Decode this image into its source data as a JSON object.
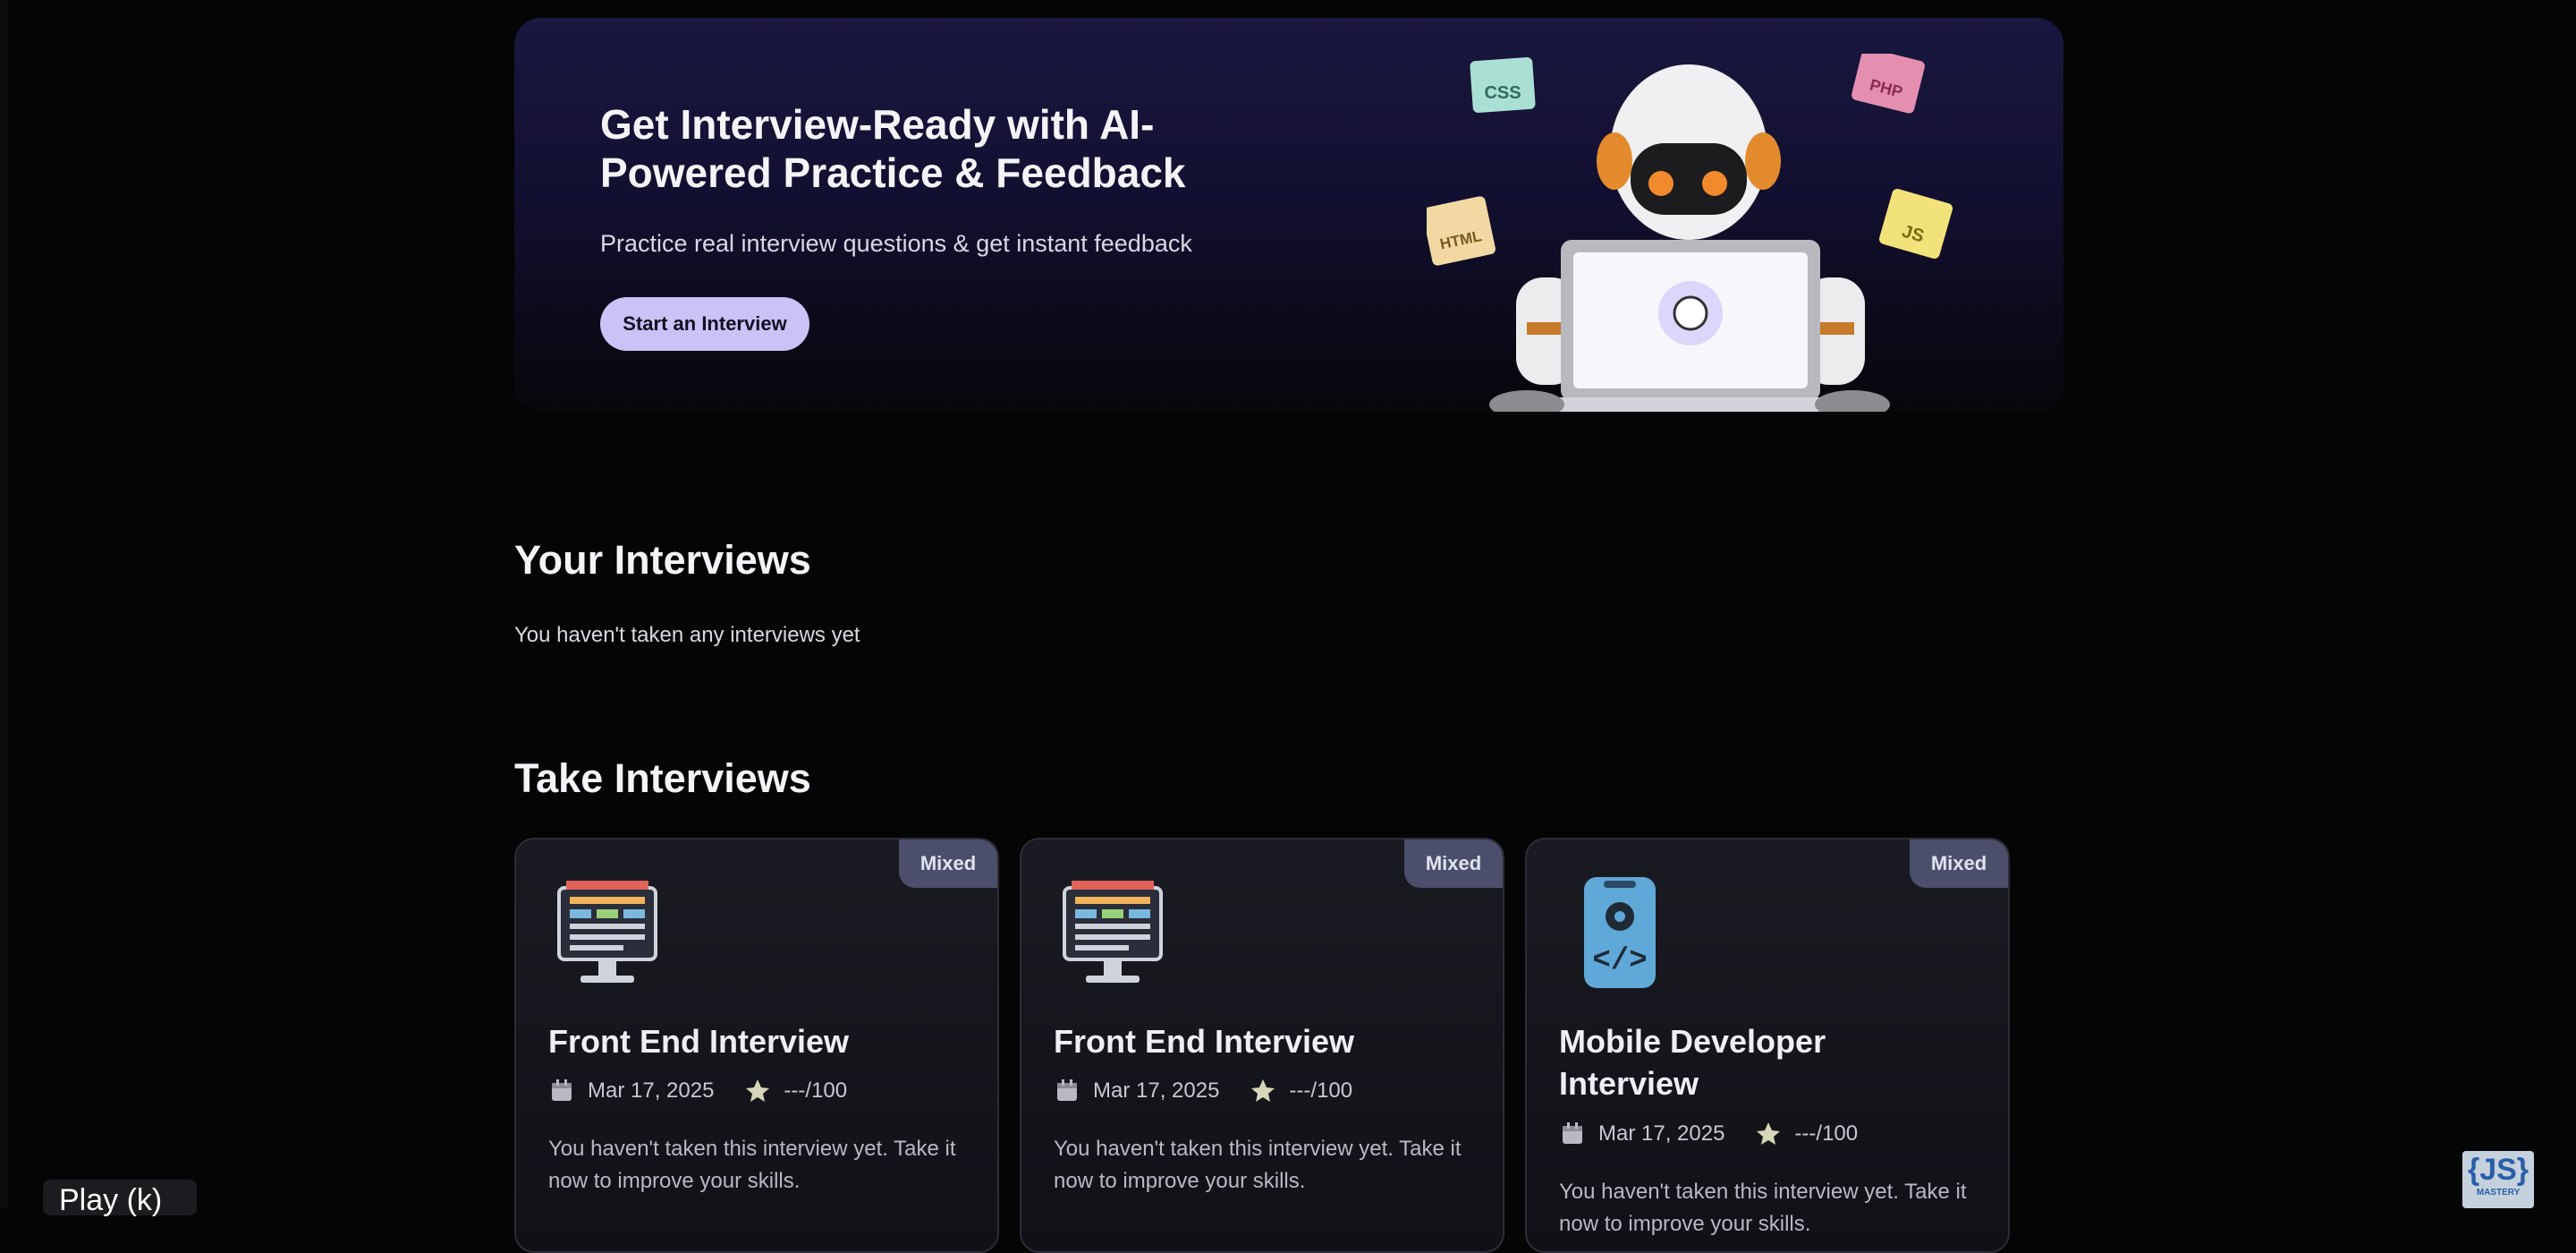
{
  "hero": {
    "title": "Get Interview-Ready with AI-Powered Practice & Feedback",
    "subtitle": "Practice real interview questions & get instant feedback",
    "button_label": "Start an Interview",
    "stickers": [
      "CSS",
      "PHP",
      "HTML",
      "JS"
    ]
  },
  "your_interviews": {
    "heading": "Your Interviews",
    "empty_message": "You haven't taken any interviews yet"
  },
  "take_interviews": {
    "heading": "Take Interviews",
    "cards": [
      {
        "badge": "Mixed",
        "title": "Front End Interview",
        "date": "Mar 17, 2025",
        "score": "---/100",
        "description": "You haven't taken this interview yet. Take it now to improve your skills.",
        "icon": "frontend-monitor-icon"
      },
      {
        "badge": "Mixed",
        "title": "Front End Interview",
        "date": "Mar 17, 2025",
        "score": "---/100",
        "description": "You haven't taken this interview yet. Take it now to improve your skills.",
        "icon": "frontend-monitor-icon"
      },
      {
        "badge": "Mixed",
        "title": "Mobile Developer Interview",
        "date": "Mar 17, 2025",
        "score": "---/100",
        "description": "You haven't taken this interview yet. Take it now to improve your skills.",
        "icon": "mobile-code-icon"
      }
    ]
  },
  "player": {
    "play_label": "Play (k)",
    "watermark": "{JS}",
    "watermark_sub": "MASTERY"
  },
  "colors": {
    "background": "#050506",
    "accent": "#c9c3f7",
    "badge": "#4b4f6b"
  }
}
